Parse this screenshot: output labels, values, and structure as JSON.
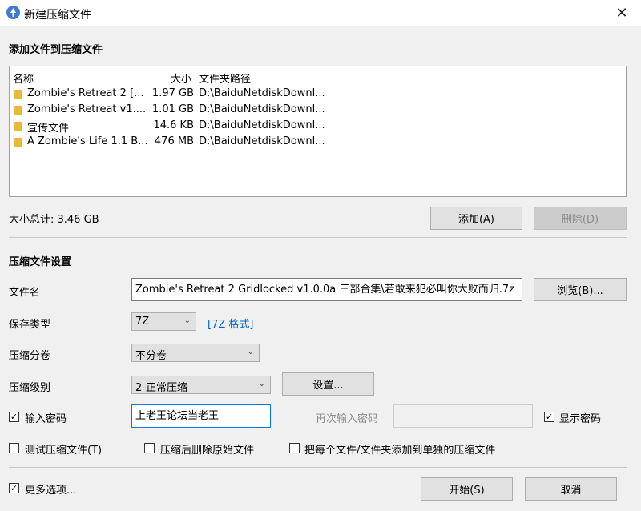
{
  "window": {
    "title": "新建压缩文件",
    "close_glyph": "✕"
  },
  "add_section": {
    "heading": "添加文件到压缩文件",
    "columns": {
      "name": "名称",
      "size": "大小",
      "path": "文件夹路径"
    },
    "files": [
      {
        "name": "Zombie's Retreat 2 [...",
        "size": "1.97 GB",
        "path": "D:\\BaiduNetdiskDownl..."
      },
      {
        "name": "Zombie's Retreat v1....",
        "size": "1.01 GB",
        "path": "D:\\BaiduNetdiskDownl..."
      },
      {
        "name": "宣传文件",
        "size": "14.6 KB",
        "path": "D:\\BaiduNetdiskDownl..."
      },
      {
        "name": "A Zombie's Life 1.1 B...",
        "size": "476 MB",
        "path": "D:\\BaiduNetdiskDownl..."
      }
    ],
    "total_label": "大小总计: 3.46 GB",
    "add_button": "添加(A)",
    "delete_button": "删除(D)"
  },
  "settings": {
    "heading": "压缩文件设置",
    "filename_label": "文件名",
    "filename_value": "Zombie's Retreat 2 Gridlocked v1.0.0a 三部合集\\若敢来犯必叫你大败而归.7z",
    "browse_button": "浏览(B)...",
    "type_label": "保存类型",
    "type_value": "7Z",
    "type_link": "[7Z 格式]",
    "volume_label": "压缩分卷",
    "volume_value": "不分卷",
    "level_label": "压缩级别",
    "level_value": "2-正常压缩",
    "settings_button": "设置...",
    "password_label": "输入密码",
    "password_value": "上老王论坛当老王",
    "repeat_password_label": "再次输入密码",
    "show_password_label": "显示密码",
    "test_label": "测试压缩文件(T)",
    "delete_after_label": "压缩后删除原始文件",
    "separate_label": "把每个文件/文件夹添加到单独的压缩文件",
    "more_options_label": "更多选项...",
    "start_button": "开始(S)",
    "cancel_button": "取消",
    "checkmark": "✓"
  }
}
